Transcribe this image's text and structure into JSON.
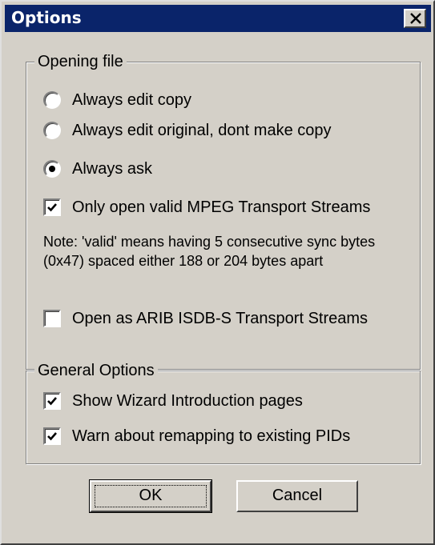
{
  "window": {
    "title": "Options",
    "close_icon": "close-icon",
    "titlebar_color": "#0a246a",
    "face_color": "#d4d0c8"
  },
  "opening_file": {
    "legend": "Opening file",
    "radios": [
      {
        "label": "Always edit copy",
        "selected": false
      },
      {
        "label": "Always edit original, dont make copy",
        "selected": false
      },
      {
        "label": "Always ask",
        "selected": true
      }
    ],
    "only_valid_mpeg": {
      "label": "Only open valid MPEG Transport Streams",
      "checked": true
    },
    "note": "Note: 'valid' means having 5 consecutive sync bytes (0x47) spaced either 188 or 204 bytes apart",
    "open_arib": {
      "label": "Open as ARIB ISDB-S Transport Streams",
      "checked": false
    }
  },
  "general_options": {
    "legend": "General Options",
    "show_wizard": {
      "label": "Show Wizard Introduction pages",
      "checked": true
    },
    "warn_remap": {
      "label": "Warn about remapping to existing PIDs",
      "checked": true
    }
  },
  "buttons": {
    "ok": "OK",
    "cancel": "Cancel"
  }
}
